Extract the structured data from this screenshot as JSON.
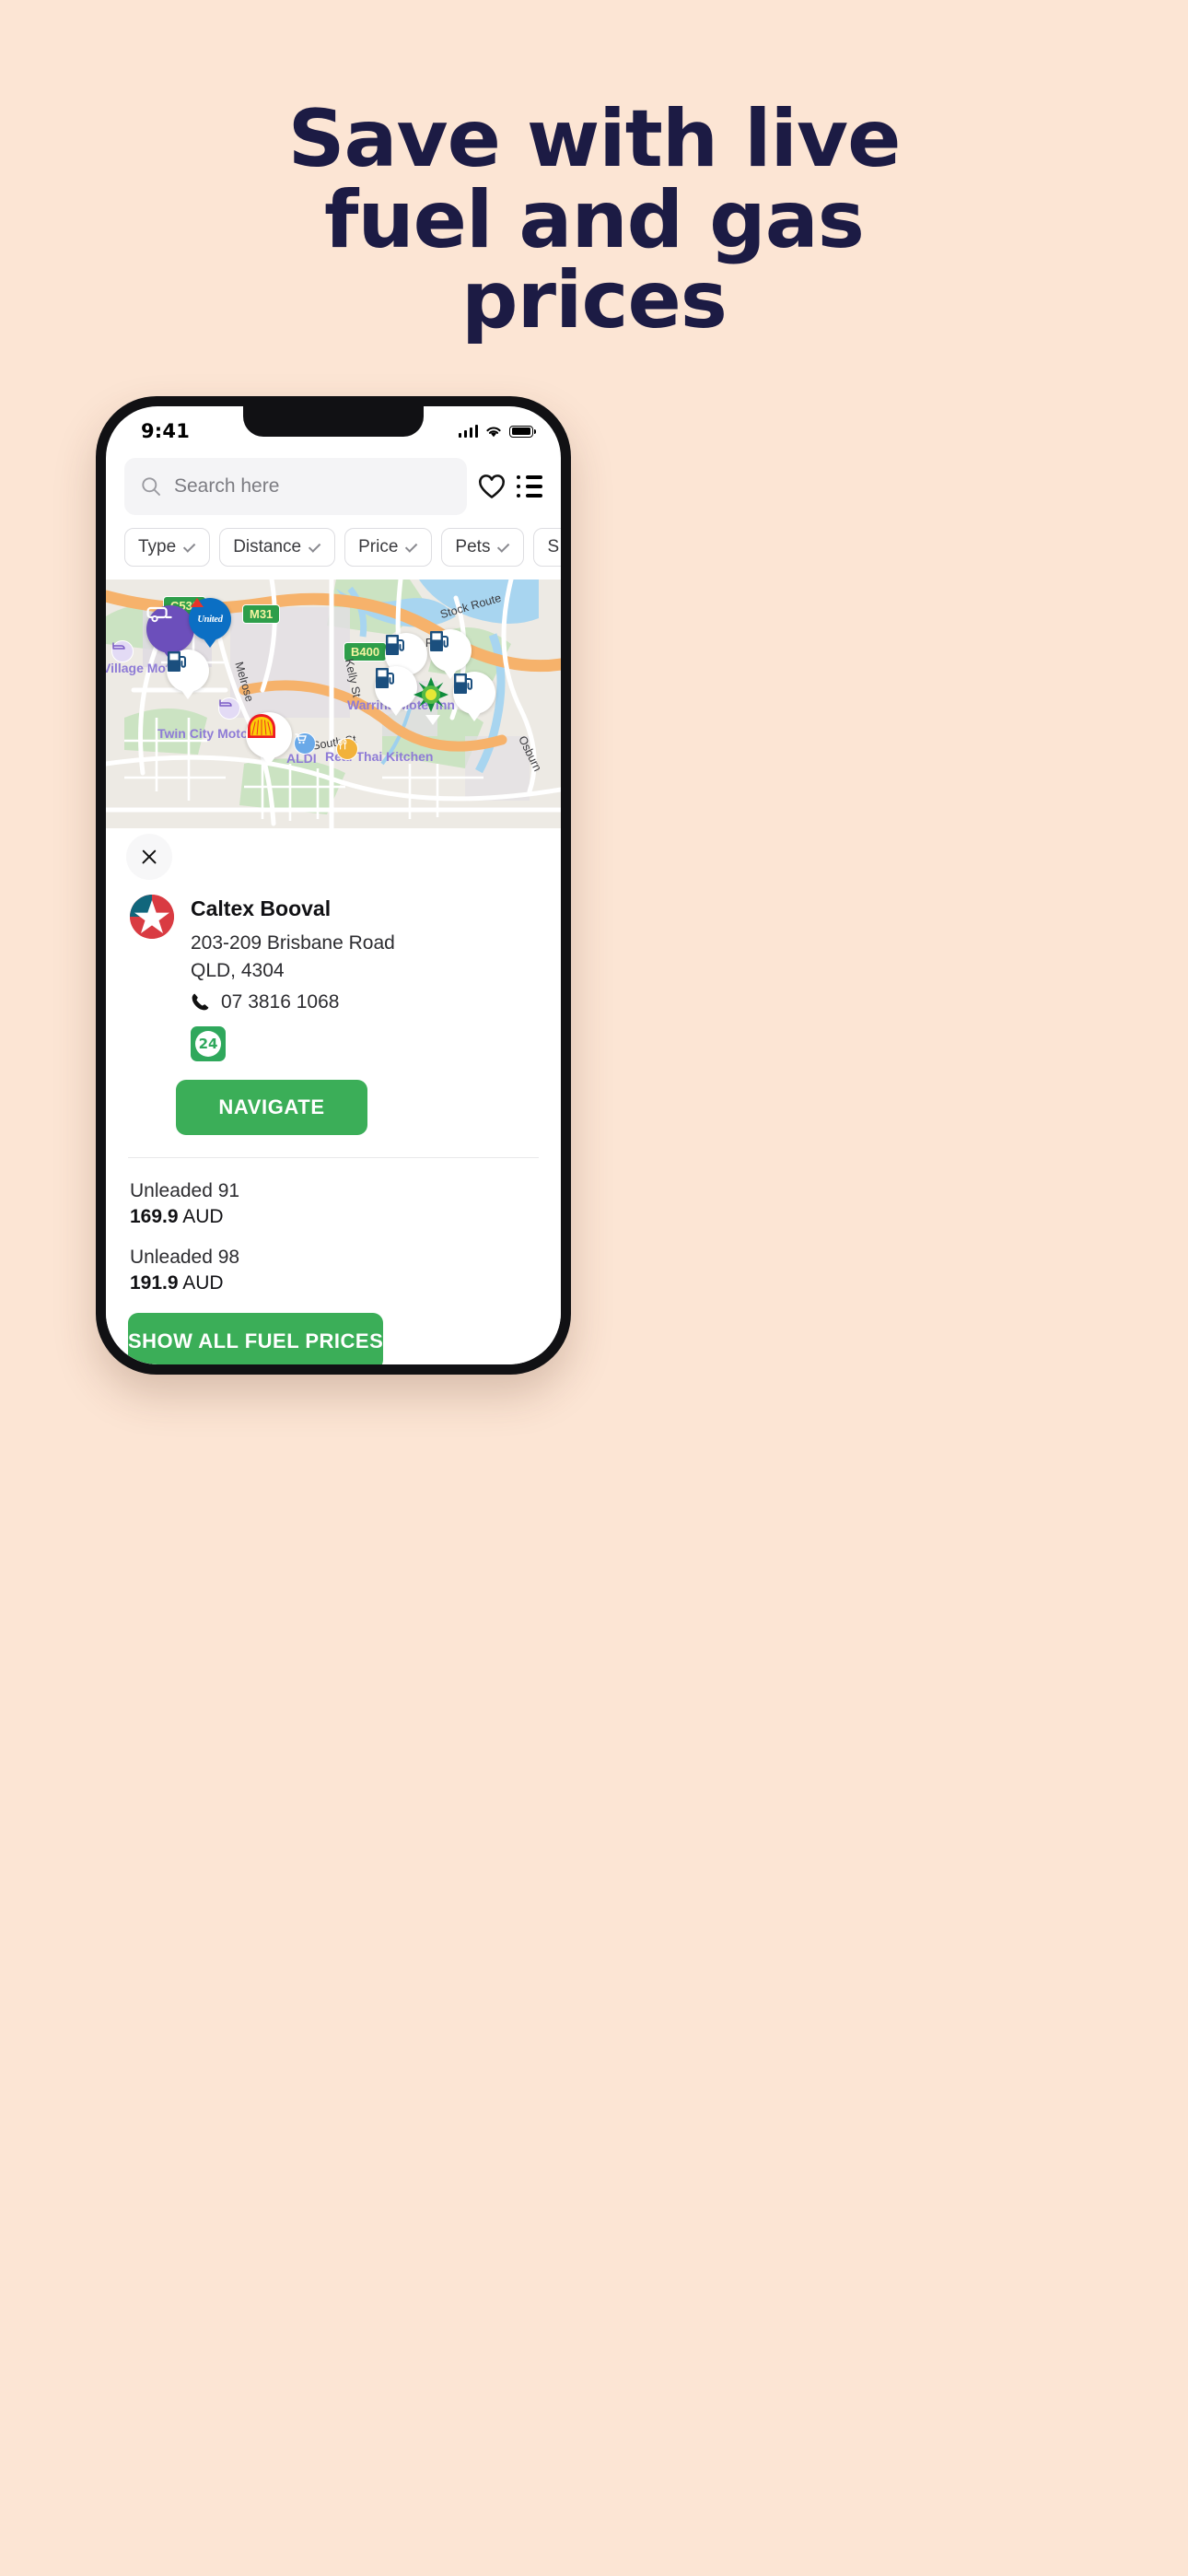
{
  "promo": {
    "headline_lines": [
      "Save with live",
      "fuel and gas",
      "prices"
    ],
    "bg_color": "#FCE5D4",
    "text_color": "#1C1B44"
  },
  "statusbar": {
    "time": "9:41",
    "signal_icon": "signal-bars-icon",
    "wifi_icon": "wifi-icon",
    "battery_icon": "battery-full-icon"
  },
  "search": {
    "placeholder": "Search here",
    "search_icon": "search-icon",
    "favorites_icon": "heart-icon",
    "list_icon": "list-view-icon"
  },
  "filters": [
    {
      "label": "Type"
    },
    {
      "label": "Distance"
    },
    {
      "label": "Price"
    },
    {
      "label": "Pets"
    },
    {
      "label": "S"
    }
  ],
  "map": {
    "road_shields": [
      {
        "label": "C538"
      },
      {
        "label": "M31"
      },
      {
        "label": "B400"
      }
    ],
    "street_labels": [
      "Stock Route",
      "Melrose",
      "Kelly St",
      "Reuss R",
      "South St",
      "Osburn"
    ],
    "poi_labels": [
      "Village Motel",
      "Warrina Motel Inn",
      "Twin City Motor Inn",
      "ALDI",
      "Real Thai Kitchen"
    ],
    "brand_pins": [
      "United",
      "BP",
      "Shell",
      "Caravan Park"
    ],
    "fuel_pin_count": 6
  },
  "sheet": {
    "close_icon": "close-icon",
    "station": {
      "brand_logo": "caltex-logo",
      "name": "Caltex Booval",
      "address_line1": "203-209 Brisbane Road",
      "address_line2": "QLD, 4304",
      "phone_icon": "phone-icon",
      "phone": "07 3816 1068",
      "open_24h_badge": "24"
    },
    "navigate_label": "NAVIGATE",
    "fuel_prices": [
      {
        "type": "Unleaded 91",
        "price": "169.9",
        "currency": "AUD"
      },
      {
        "type": "Unleaded 98",
        "price": "191.9",
        "currency": "AUD"
      }
    ],
    "show_all_label": "SHOW ALL FUEL PRICES",
    "accent_green": "#3BAE58"
  }
}
